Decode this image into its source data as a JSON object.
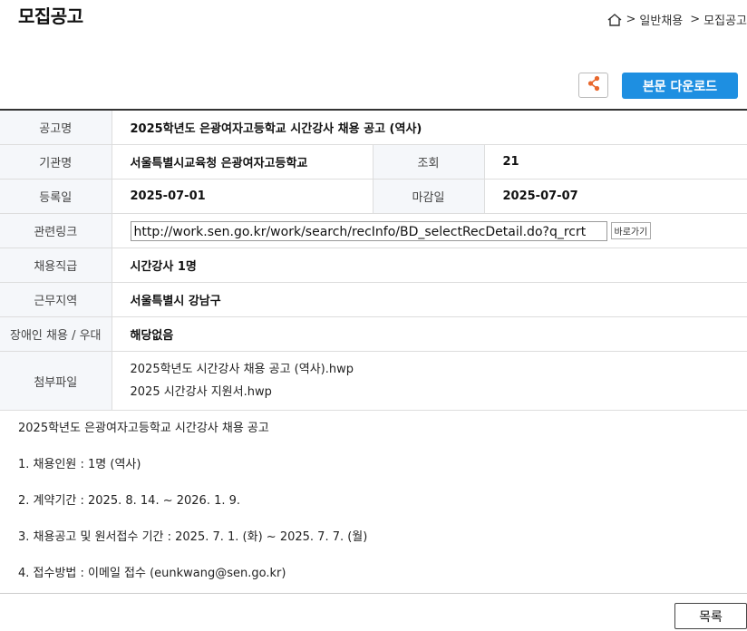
{
  "header": {
    "title": "모집공고"
  },
  "breadcrumb": {
    "sep": ">",
    "item1": "일반채용",
    "item2": "모집공고"
  },
  "actions": {
    "download_label": "본문 다운로드"
  },
  "labels": {
    "title": "공고명",
    "org": "기관명",
    "views": "조회",
    "reg_date": "등록일",
    "deadline": "마감일",
    "link": "관련링크",
    "position": "채용직급",
    "location": "근무지역",
    "disability": "장애인 채용 / 우대",
    "attachments": "첨부파일"
  },
  "values": {
    "title": "2025학년도 은광여자고등학교 시간강사 채용 공고 (역사)",
    "org": "서울특별시교육청 은광여자고등학교",
    "views": "21",
    "reg_date": "2025-07-01",
    "deadline": "2025-07-07",
    "link": "http://work.sen.go.kr/work/search/recInfo/BD_selectRecDetail.do?q_rcrt",
    "goto_label": "바로가기",
    "position": "시간강사 1명",
    "location": "서울특별시 강남구",
    "disability": "해당없음",
    "attachments": [
      "2025학년도 시간강사 채용 공고 (역사).hwp",
      "2025 시간강사 지원서.hwp"
    ]
  },
  "body": {
    "lines": [
      "2025학년도 은광여자고등학교 시간강사 채용 공고",
      "1. 채용인원 : 1명 (역사)",
      "2. 계약기간 : 2025. 8. 14. ~ 2026. 1. 9.",
      "3. 채용공고 및 원서접수 기간 : 2025. 7. 1. (화) ~ 2025. 7. 7. (월)",
      "4. 접수방법 :  이메일 접수 (eunkwang@sen.go.kr)"
    ]
  },
  "footer": {
    "list_label": "목록"
  },
  "colors": {
    "accent": "#1e8fe1",
    "share_icon": "#e8672c"
  }
}
